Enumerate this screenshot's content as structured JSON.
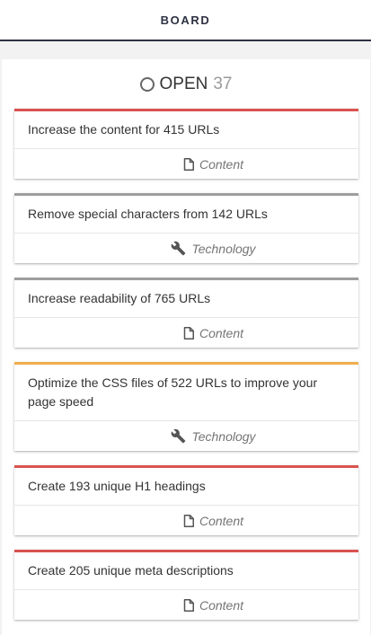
{
  "header": {
    "tab_label": "BOARD"
  },
  "column": {
    "title": "OPEN",
    "count": "37"
  },
  "cards": [
    {
      "title": "Increase the content for 415 URLs",
      "category": "Content",
      "icon": "document-icon",
      "accent": "#d9534f"
    },
    {
      "title": "Remove special characters from 142 URLs",
      "category": "Technology",
      "icon": "wrench-icon",
      "accent": "#9e9e9e"
    },
    {
      "title": "Increase readability of 765 URLs",
      "category": "Content",
      "icon": "document-icon",
      "accent": "#9e9e9e"
    },
    {
      "title": "Optimize the CSS files of 522 URLs to improve your page speed",
      "category": "Technology",
      "icon": "wrench-icon",
      "accent": "#f0ad4e"
    },
    {
      "title": "Create 193 unique H1 headings",
      "category": "Content",
      "icon": "document-icon",
      "accent": "#d9534f"
    },
    {
      "title": "Create 205 unique meta descriptions",
      "category": "Content",
      "icon": "document-icon",
      "accent": "#d9534f"
    }
  ]
}
